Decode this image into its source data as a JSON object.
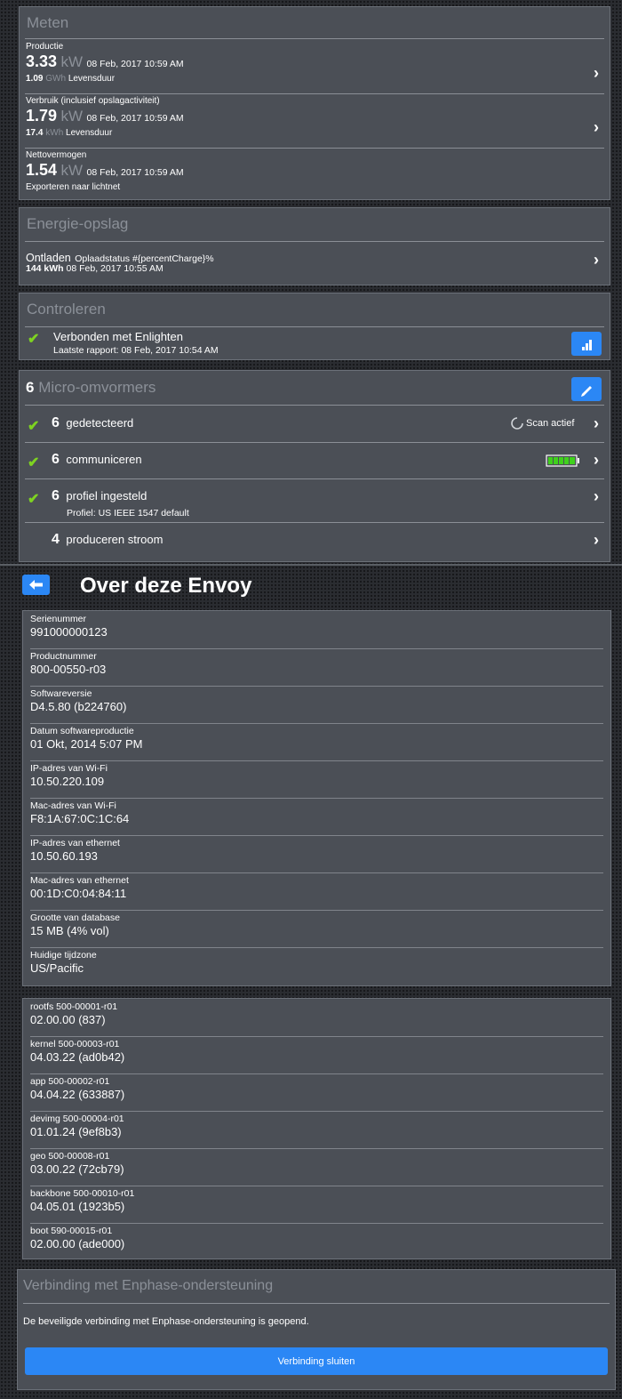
{
  "meten": {
    "title": "Meten",
    "productie": {
      "label": "Productie",
      "value": "3.33",
      "unit": "kW",
      "time": "08 Feb, 2017 10:59 AM",
      "life_value": "1.09",
      "life_unit": "GWh",
      "life_label": "Levensduur"
    },
    "verbruik": {
      "label": "Verbruik (inclusief opslagactiviteit)",
      "value": "1.79",
      "unit": "kW",
      "time": "08 Feb, 2017 10:59 AM",
      "life_value": "17.4",
      "life_unit": "kWh",
      "life_label": "Levensduur"
    },
    "netto": {
      "label": "Nettovermogen",
      "value": "1.54",
      "unit": "kW",
      "time": "08 Feb, 2017 10:59 AM",
      "sub": "Exporteren naar lichtnet"
    }
  },
  "opslag": {
    "title": "Energie-opslag",
    "status": "Ontladen",
    "charge": "Oplaadstatus #{percentCharge}%",
    "energy": "144 kWh",
    "time": "08 Feb, 2017 10:55 AM"
  },
  "controleren": {
    "title": "Controleren",
    "status": "Verbonden met Enlighten",
    "report": "Laatste rapport: 08 Feb, 2017 10:54 AM"
  },
  "micro": {
    "count": "6",
    "title": "Micro-omvormers",
    "detected_count": "6",
    "detected_label": "gedetecteerd",
    "scan_label": "Scan actief",
    "comm_count": "6",
    "comm_label": "communiceren",
    "profile_count": "6",
    "profile_label": "profiel ingesteld",
    "profile_sub": "Profiel: US IEEE 1547 default",
    "produce_count": "4",
    "produce_label": "produceren stroom"
  },
  "about": {
    "title": "Over deze Envoy",
    "items": [
      {
        "label": "Serienummer",
        "value": "991000000123"
      },
      {
        "label": "Productnummer",
        "value": "800-00550-r03"
      },
      {
        "label": "Softwareversie",
        "value": "D4.5.80 (b224760)"
      },
      {
        "label": "Datum softwareproductie",
        "value": "01 Okt, 2014 5:07 PM"
      },
      {
        "label": "IP-adres van Wi-Fi",
        "value": "10.50.220.109"
      },
      {
        "label": "Mac-adres van Wi-Fi",
        "value": "F8:1A:67:0C:1C:64"
      },
      {
        "label": "IP-adres van ethernet",
        "value": "10.50.60.193"
      },
      {
        "label": "Mac-adres van ethernet",
        "value": "00:1D:C0:04:84:11"
      },
      {
        "label": "Grootte van database",
        "value": "15 MB (4% vol)"
      },
      {
        "label": "Huidige tijdzone",
        "value": "US/Pacific"
      }
    ]
  },
  "firmware": {
    "items": [
      {
        "label": "rootfs 500-00001-r01",
        "value": "02.00.00 (837)"
      },
      {
        "label": "kernel 500-00003-r01",
        "value": "04.03.22 (ad0b42)"
      },
      {
        "label": "app 500-00002-r01",
        "value": "04.04.22 (633887)"
      },
      {
        "label": "devimg 500-00004-r01",
        "value": "01.01.24 (9ef8b3)"
      },
      {
        "label": "geo 500-00008-r01",
        "value": "03.00.22 (72cb79)"
      },
      {
        "label": "backbone 500-00010-r01",
        "value": "04.05.01 (1923b5)"
      },
      {
        "label": "boot 590-00015-r01",
        "value": "02.00.00 (ade000)"
      }
    ]
  },
  "support": {
    "title": "Verbinding met Enphase-ondersteuning",
    "message": "De beveiligde verbinding met Enphase-ondersteuning is geopend.",
    "button": "Verbinding sluiten"
  },
  "icons": {
    "chevron": "chevron-right-icon",
    "check": "check-icon",
    "signal": "signal-icon",
    "edit": "pencil-icon",
    "back": "arrow-left-icon",
    "spinner": "spinner-icon",
    "battery": "battery-icon"
  },
  "colors": {
    "accent": "#2b87f5",
    "ok": "#7ed321",
    "panel": "#4b4f56",
    "muted": "#8b9098"
  }
}
